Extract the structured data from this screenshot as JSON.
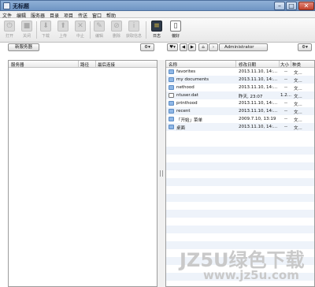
{
  "window": {
    "title": "无标题"
  },
  "menu": [
    "文件",
    "编辑",
    "服务器",
    "目录",
    "项目",
    "传送",
    "窗口",
    "帮助"
  ],
  "toolbar": {
    "items": [
      {
        "label": "打开",
        "icon": "open-icon"
      },
      {
        "label": "关闭",
        "icon": "close-icon"
      },
      {
        "label": "下载",
        "icon": "download-icon"
      },
      {
        "label": "上传",
        "icon": "upload-icon"
      },
      {
        "label": "中止",
        "icon": "stop-icon"
      },
      {
        "label": "编辑",
        "icon": "edit-icon"
      },
      {
        "label": "删除",
        "icon": "delete-icon"
      },
      {
        "label": "获取信息",
        "icon": "info-icon"
      },
      {
        "label": "日志",
        "icon": "log-icon"
      },
      {
        "label": "偏好",
        "icon": "preferences-icon"
      }
    ]
  },
  "left": {
    "new_server": "新服务器",
    "columns": [
      "服务器",
      "路径",
      "最后连接"
    ]
  },
  "right": {
    "path": "Administrator",
    "columns": [
      "名称",
      "修改日期",
      "大小",
      "种类"
    ],
    "files": [
      {
        "name": "favorites",
        "date": "2013.11.10, 14:...",
        "size": "--",
        "kind": "文...",
        "type": "folder"
      },
      {
        "name": "my documents",
        "date": "2013.11.10, 14:...",
        "size": "--",
        "kind": "文...",
        "type": "folder"
      },
      {
        "name": "nethood",
        "date": "2013.11.10, 14:...",
        "size": "--",
        "kind": "文...",
        "type": "folder"
      },
      {
        "name": "ntuser.dat",
        "date": "昨天, 23:07",
        "size": "1.2...",
        "kind": "文...",
        "type": "file"
      },
      {
        "name": "printhood",
        "date": "2013.11.10, 14:...",
        "size": "--",
        "kind": "文...",
        "type": "folder"
      },
      {
        "name": "recent",
        "date": "2013.11.10, 14:...",
        "size": "--",
        "kind": "文...",
        "type": "folder"
      },
      {
        "name": "「开始」菜单",
        "date": "2009.7.10, 13:19",
        "size": "--",
        "kind": "文...",
        "type": "folder"
      },
      {
        "name": "桌面",
        "date": "2013.11.10, 14:...",
        "size": "--",
        "kind": "文...",
        "type": "folder"
      }
    ]
  },
  "watermark": {
    "line1": "JZ5U绿色下载",
    "line2": "www.jz5u.com"
  }
}
